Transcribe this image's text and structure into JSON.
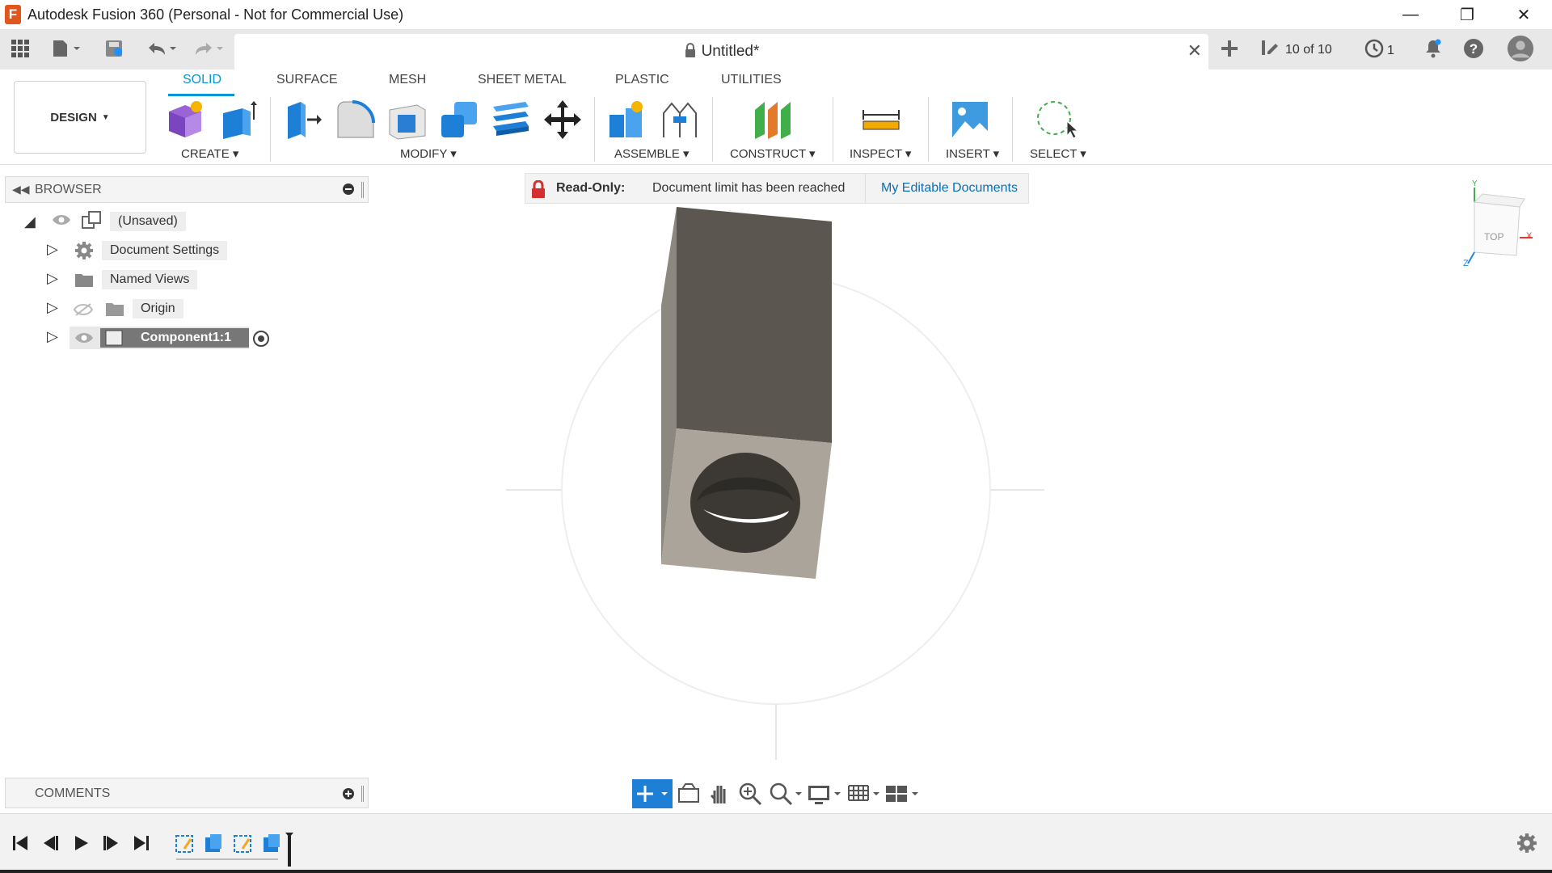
{
  "window": {
    "app_icon": "F",
    "title": "Autodesk Fusion 360 (Personal - Not for Commercial Use)",
    "minimize": "—",
    "maximize": "❐",
    "close": "✕"
  },
  "doc_tab": {
    "title": "Untitled*",
    "lock_icon": "lock-icon"
  },
  "top_right": {
    "version": "10 of 10",
    "jobs": "1"
  },
  "ribbon": {
    "tabs": [
      {
        "label": "SOLID",
        "active": true
      },
      {
        "label": "SURFACE",
        "active": false
      },
      {
        "label": "MESH",
        "active": false
      },
      {
        "label": "SHEET METAL",
        "active": false
      },
      {
        "label": "PLASTIC",
        "active": false
      },
      {
        "label": "UTILITIES",
        "active": false
      }
    ],
    "workspace": "DESIGN",
    "groups": {
      "create": "CREATE",
      "modify": "MODIFY",
      "assemble": "ASSEMBLE",
      "construct": "CONSTRUCT",
      "inspect": "INSPECT",
      "insert": "INSERT",
      "select": "SELECT"
    }
  },
  "browser": {
    "title": "BROWSER",
    "items": [
      {
        "label": "(Unsaved)"
      },
      {
        "label": "Document Settings"
      },
      {
        "label": "Named Views"
      },
      {
        "label": "Origin"
      },
      {
        "label": "Component1:1"
      }
    ]
  },
  "banner": {
    "prefix": "Read-Only:",
    "message": "Document limit has been reached",
    "link": "My Editable Documents"
  },
  "viewcube": {
    "top": "TOP",
    "axis_x": "X",
    "axis_y": "Y",
    "axis_z": "Z"
  },
  "comments": {
    "title": "COMMENTS"
  },
  "colors": {
    "accent": "#0696d7",
    "ribbon_bg": "#ffffff",
    "model_top": "#5b5750",
    "model_front": "#aaa49a"
  }
}
